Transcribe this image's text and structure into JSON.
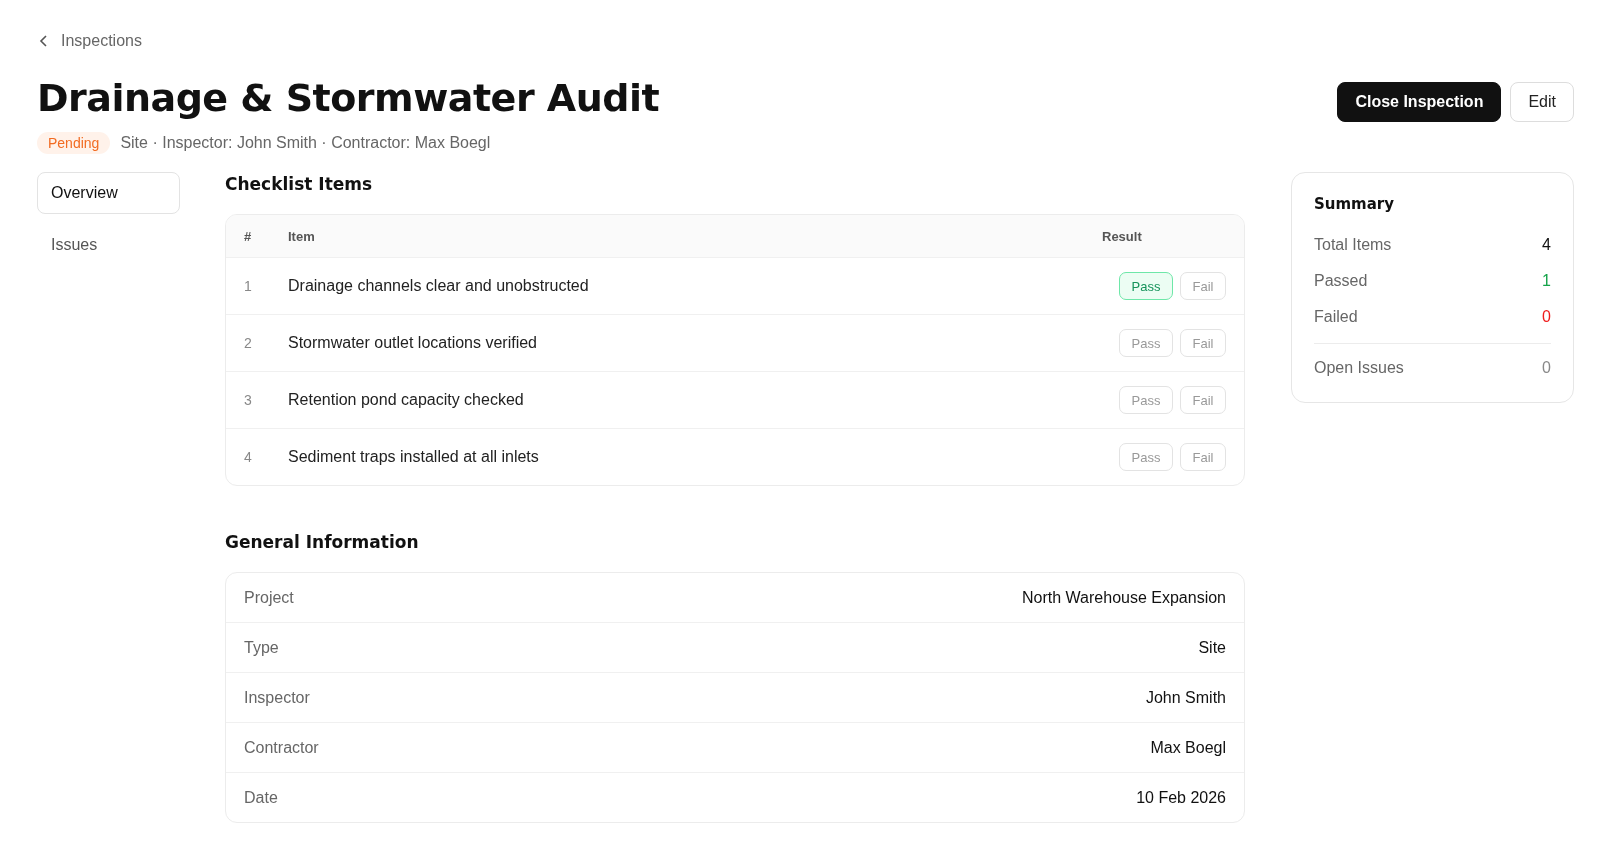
{
  "breadcrumb": {
    "label": "Inspections"
  },
  "title": "Drainage & Stormwater Audit",
  "status_badge": "Pending",
  "meta": "Site · Inspector: John Smith · Contractor: Max Boegl",
  "actions": [
    {
      "label": "Close Inspection",
      "kind": "primary"
    },
    {
      "label": "Edit",
      "kind": "secondary"
    }
  ],
  "tabs": [
    {
      "label": "Overview",
      "selected": true
    },
    {
      "label": "Issues",
      "selected": false
    }
  ],
  "checklist": {
    "title": "Checklist Items",
    "columns": [
      "#",
      "Item",
      "Result"
    ],
    "items": [
      {
        "number": "1",
        "item": "Drainage channels clear and unobstructed",
        "buttons": [
          {
            "label": "Pass",
            "kind": "pass",
            "selected": true
          },
          {
            "label": "Fail",
            "kind": "fail",
            "selected": false
          }
        ]
      },
      {
        "number": "2",
        "item": "Stormwater outlet locations verified",
        "buttons": [
          {
            "label": "Pass",
            "kind": "pass",
            "selected": false
          },
          {
            "label": "Fail",
            "kind": "fail",
            "selected": false
          }
        ]
      },
      {
        "number": "3",
        "item": "Retention pond capacity checked",
        "buttons": [
          {
            "label": "Pass",
            "kind": "pass",
            "selected": false
          },
          {
            "label": "Fail",
            "kind": "fail",
            "selected": false
          }
        ]
      },
      {
        "number": "4",
        "item": "Sediment traps installed at all inlets",
        "buttons": [
          {
            "label": "Pass",
            "kind": "pass",
            "selected": false
          },
          {
            "label": "Fail",
            "kind": "fail",
            "selected": false
          }
        ]
      }
    ]
  },
  "general_information": {
    "title": "General Information",
    "rows": [
      {
        "label": "Project",
        "value": "North Warehouse Expansion"
      },
      {
        "label": "Type",
        "value": "Site"
      },
      {
        "label": "Inspector",
        "value": "John Smith"
      },
      {
        "label": "Contractor",
        "value": "Max Boegl"
      },
      {
        "label": "Date",
        "value": "10 Feb 2026"
      }
    ]
  },
  "summary": {
    "title": "Summary",
    "stats": [
      {
        "label": "Total Items",
        "value": "4",
        "color": "#111111"
      },
      {
        "label": "Passed",
        "value": "1",
        "color": "#16a34a"
      },
      {
        "label": "Failed",
        "value": "0",
        "color": "#ef1c1c"
      }
    ],
    "open_issues": {
      "label": "Open Issues",
      "value": "0"
    }
  }
}
